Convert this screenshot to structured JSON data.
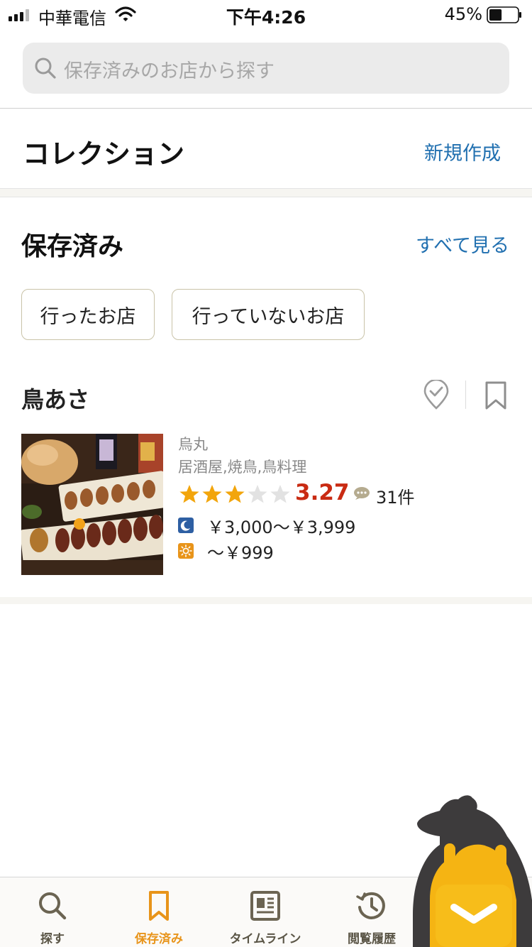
{
  "status_bar": {
    "carrier": "中華電信",
    "time": "下午4:26",
    "battery_percent": "45%",
    "battery_level": 0.45
  },
  "search": {
    "placeholder": "保存済みのお店から探す"
  },
  "collection": {
    "title": "コレクション",
    "new_label": "新規作成"
  },
  "saved": {
    "title": "保存済み",
    "see_all_label": "すべて見る",
    "filters": [
      "行ったお店",
      "行っていないお店"
    ]
  },
  "restaurant": {
    "name": "鳥あさ",
    "area": "烏丸",
    "genre": "居酒屋,焼鳥,鳥料理",
    "rating_value": 3.27,
    "rating": "3.27",
    "review_count": "31件",
    "dinner_price": "￥3,000～￥3,999",
    "lunch_price": "～￥999",
    "dinner_icon": "moon-icon",
    "lunch_icon": "sun-icon"
  },
  "tabs": [
    {
      "label": "探す",
      "icon": "search-icon",
      "active": false
    },
    {
      "label": "保存済み",
      "icon": "bookmark-icon",
      "active": true
    },
    {
      "label": "タイムライン",
      "icon": "newspaper-icon",
      "active": false
    },
    {
      "label": "閲覧履歴",
      "icon": "history-icon",
      "active": false
    }
  ],
  "colors": {
    "link": "#2170b0",
    "rating": "#c92b13",
    "star": "#f2a50c",
    "active_tab": "#e8941a",
    "dinner_icon_bg": "#2e5fa3",
    "lunch_icon_bg": "#e8941a"
  }
}
